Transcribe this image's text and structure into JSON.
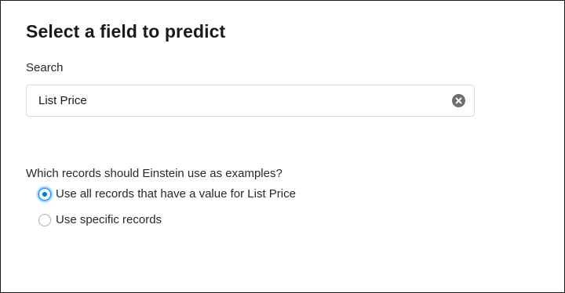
{
  "page": {
    "title": "Select a field to predict"
  },
  "search": {
    "label": "Search",
    "value": "List Price",
    "clear_icon": "clear-circle-icon"
  },
  "examples": {
    "question": "Which records should Einstein use as examples?",
    "options": [
      {
        "label": "Use all records that have a value for List Price",
        "selected": true
      },
      {
        "label": "Use specific records",
        "selected": false
      }
    ]
  },
  "colors": {
    "accent": "#0176d3",
    "focus_ring": "#1b96ff",
    "clear_icon": "#706e6b"
  }
}
